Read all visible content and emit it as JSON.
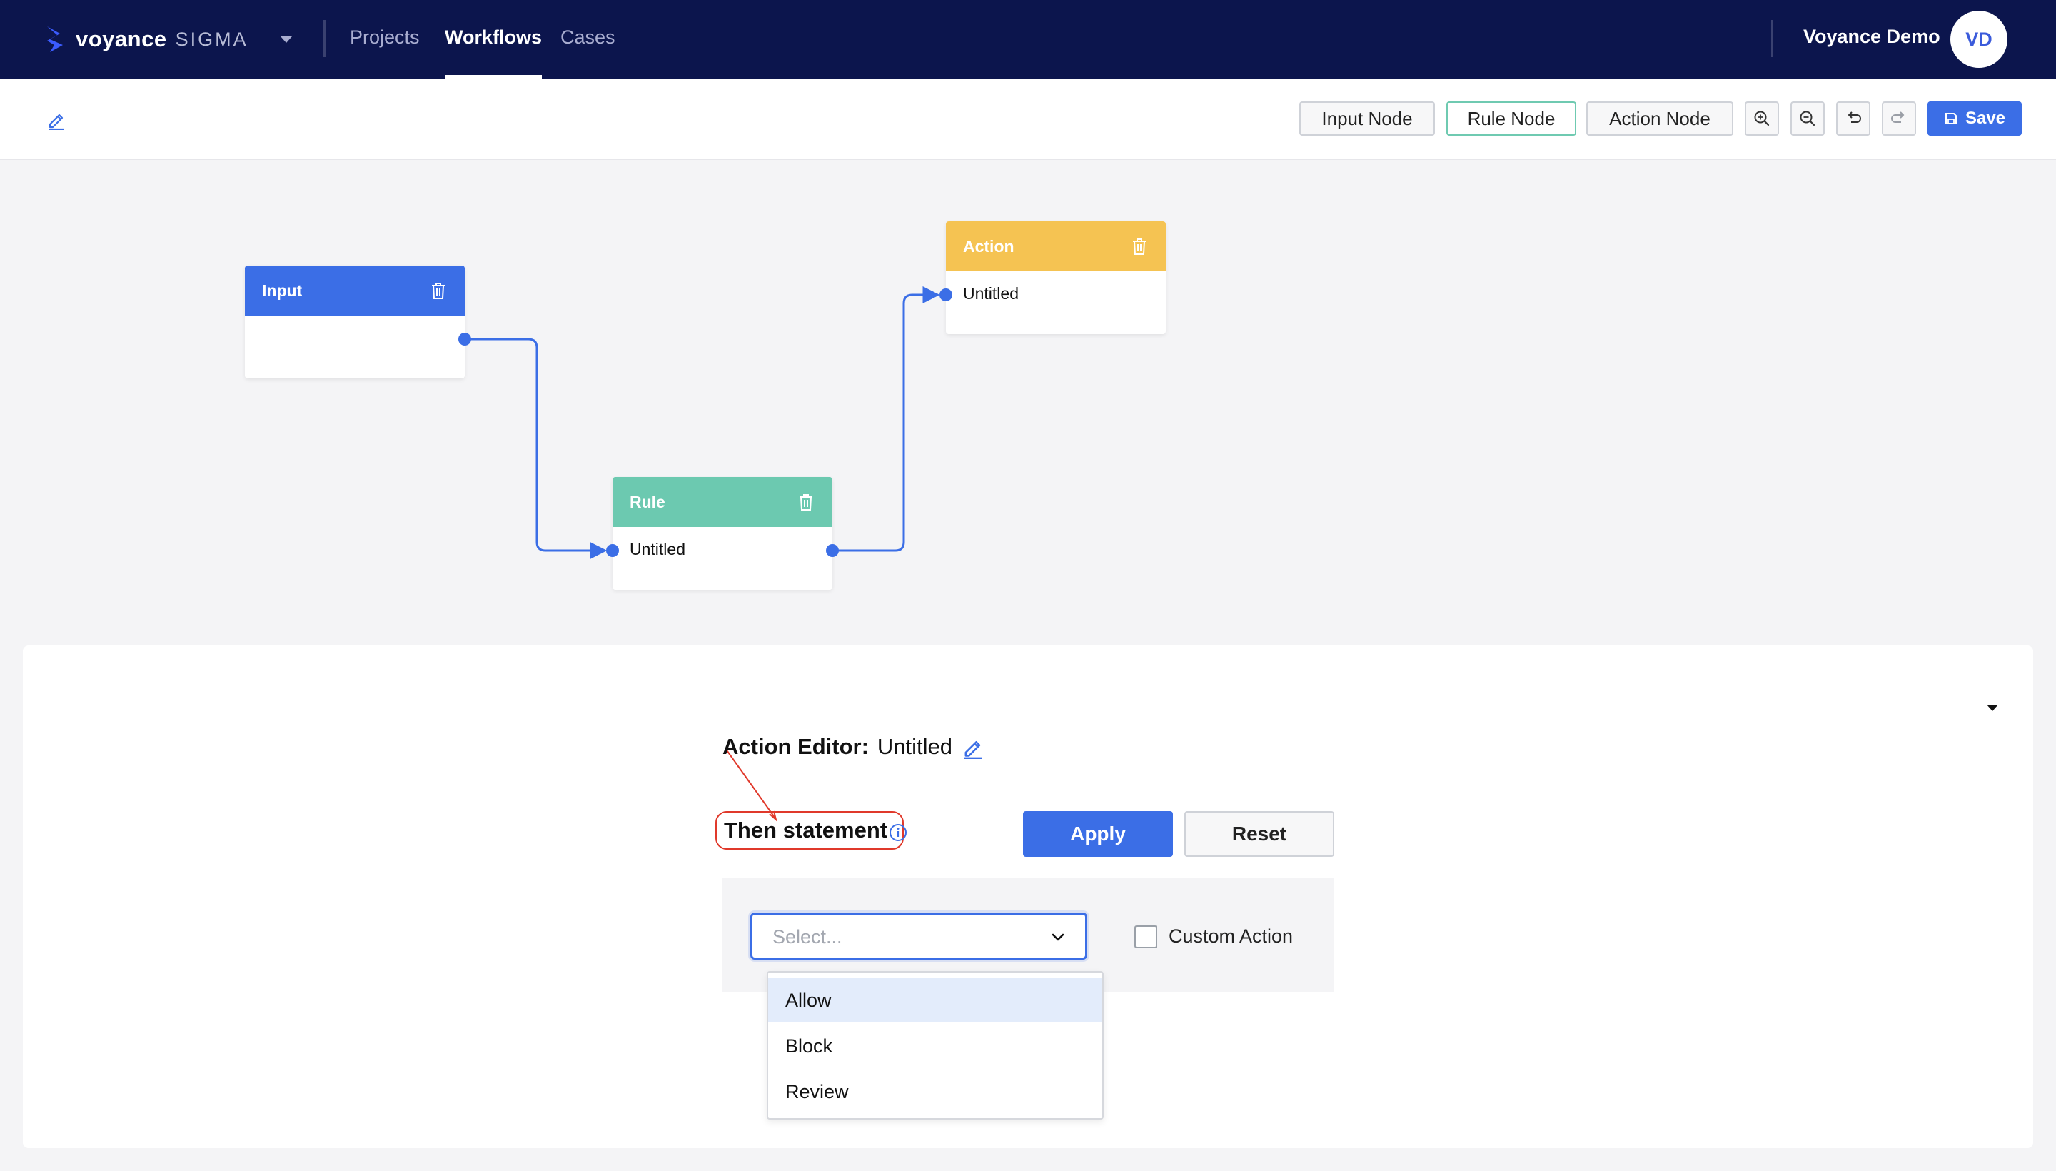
{
  "nav": {
    "logo_word": "voyance",
    "logo_sub": "SIGMA",
    "items": [
      {
        "label": "Projects"
      },
      {
        "label": "Workflows"
      },
      {
        "label": "Cases"
      }
    ],
    "active_item": "Workflows",
    "user_name": "Voyance Demo",
    "avatar_initials": "VD"
  },
  "toolbar": {
    "input_node_label": "Input Node",
    "rule_node_label": "Rule Node",
    "action_node_label": "Action Node",
    "save_label": "Save",
    "icons": [
      "edit-icon",
      "zoom-in-icon",
      "zoom-out-icon",
      "undo-icon",
      "redo-icon",
      "save-icon"
    ]
  },
  "canvas": {
    "nodes": [
      {
        "type": "Input",
        "title": "Input",
        "name": "",
        "color": "#3b6ee6"
      },
      {
        "type": "Rule",
        "title": "Rule",
        "name": "Untitled",
        "color": "#6cc9b0"
      },
      {
        "type": "Action",
        "title": "Action",
        "name": "Untitled",
        "color": "#f5c352"
      }
    ],
    "edge_color": "#3b6ee6"
  },
  "editor": {
    "title_label": "Action Editor:",
    "title_value": "Untitled",
    "then_label": "Then statement",
    "apply_label": "Apply",
    "reset_label": "Reset",
    "select_placeholder": "Select...",
    "custom_action_label": "Custom Action",
    "options": [
      "Allow",
      "Block",
      "Review"
    ],
    "highlighted_option": "Allow",
    "annotation_color": "#e0392b"
  },
  "colors": {
    "nav_bg": "#0c154d",
    "accent": "#3b6ee6",
    "rule_green": "#6cc9b0",
    "action_yellow": "#f5c352"
  }
}
